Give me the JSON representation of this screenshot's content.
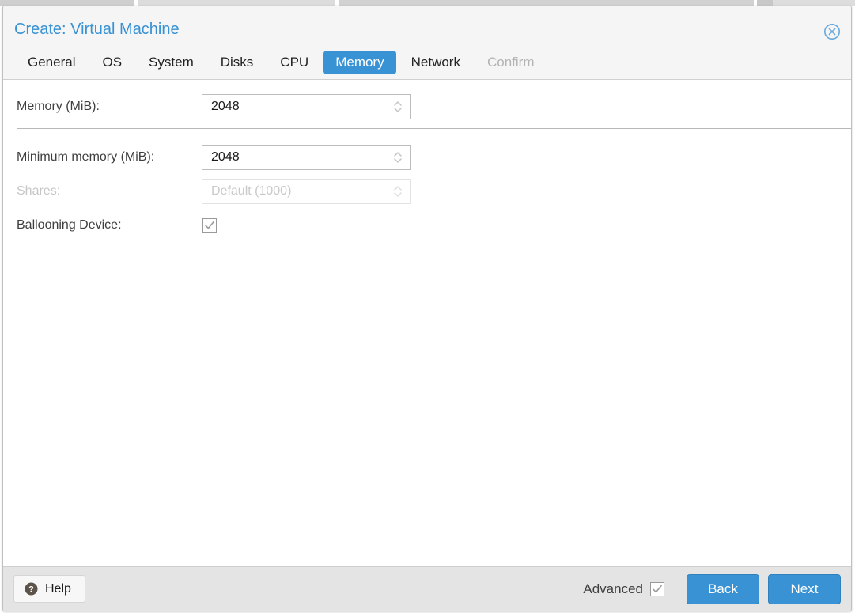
{
  "window": {
    "title": "Create: Virtual Machine",
    "close_icon": "close-circle-icon"
  },
  "tabs": [
    {
      "label": "General",
      "state": "normal"
    },
    {
      "label": "OS",
      "state": "normal"
    },
    {
      "label": "System",
      "state": "normal"
    },
    {
      "label": "Disks",
      "state": "normal"
    },
    {
      "label": "CPU",
      "state": "normal"
    },
    {
      "label": "Memory",
      "state": "active"
    },
    {
      "label": "Network",
      "state": "normal"
    },
    {
      "label": "Confirm",
      "state": "disabled"
    }
  ],
  "form": {
    "memory": {
      "label": "Memory (MiB):",
      "value": "2048"
    },
    "minimum_memory": {
      "label": "Minimum memory (MiB):",
      "value": "2048"
    },
    "shares": {
      "label": "Shares:",
      "placeholder": "Default (1000)",
      "value": ""
    },
    "ballooning_device": {
      "label": "Ballooning Device:",
      "checked": true
    }
  },
  "footer": {
    "help_label": "Help",
    "help_icon": "question-circle-icon",
    "advanced_label": "Advanced",
    "advanced_checked": true,
    "back_label": "Back",
    "next_label": "Next"
  },
  "colors": {
    "accent": "#3892d4",
    "title": "#3892d4",
    "header_bg": "#f5f5f5",
    "footer_bg": "#e4e4e4",
    "label": "#3f3f3f",
    "disabled": "#c6c6c6"
  }
}
